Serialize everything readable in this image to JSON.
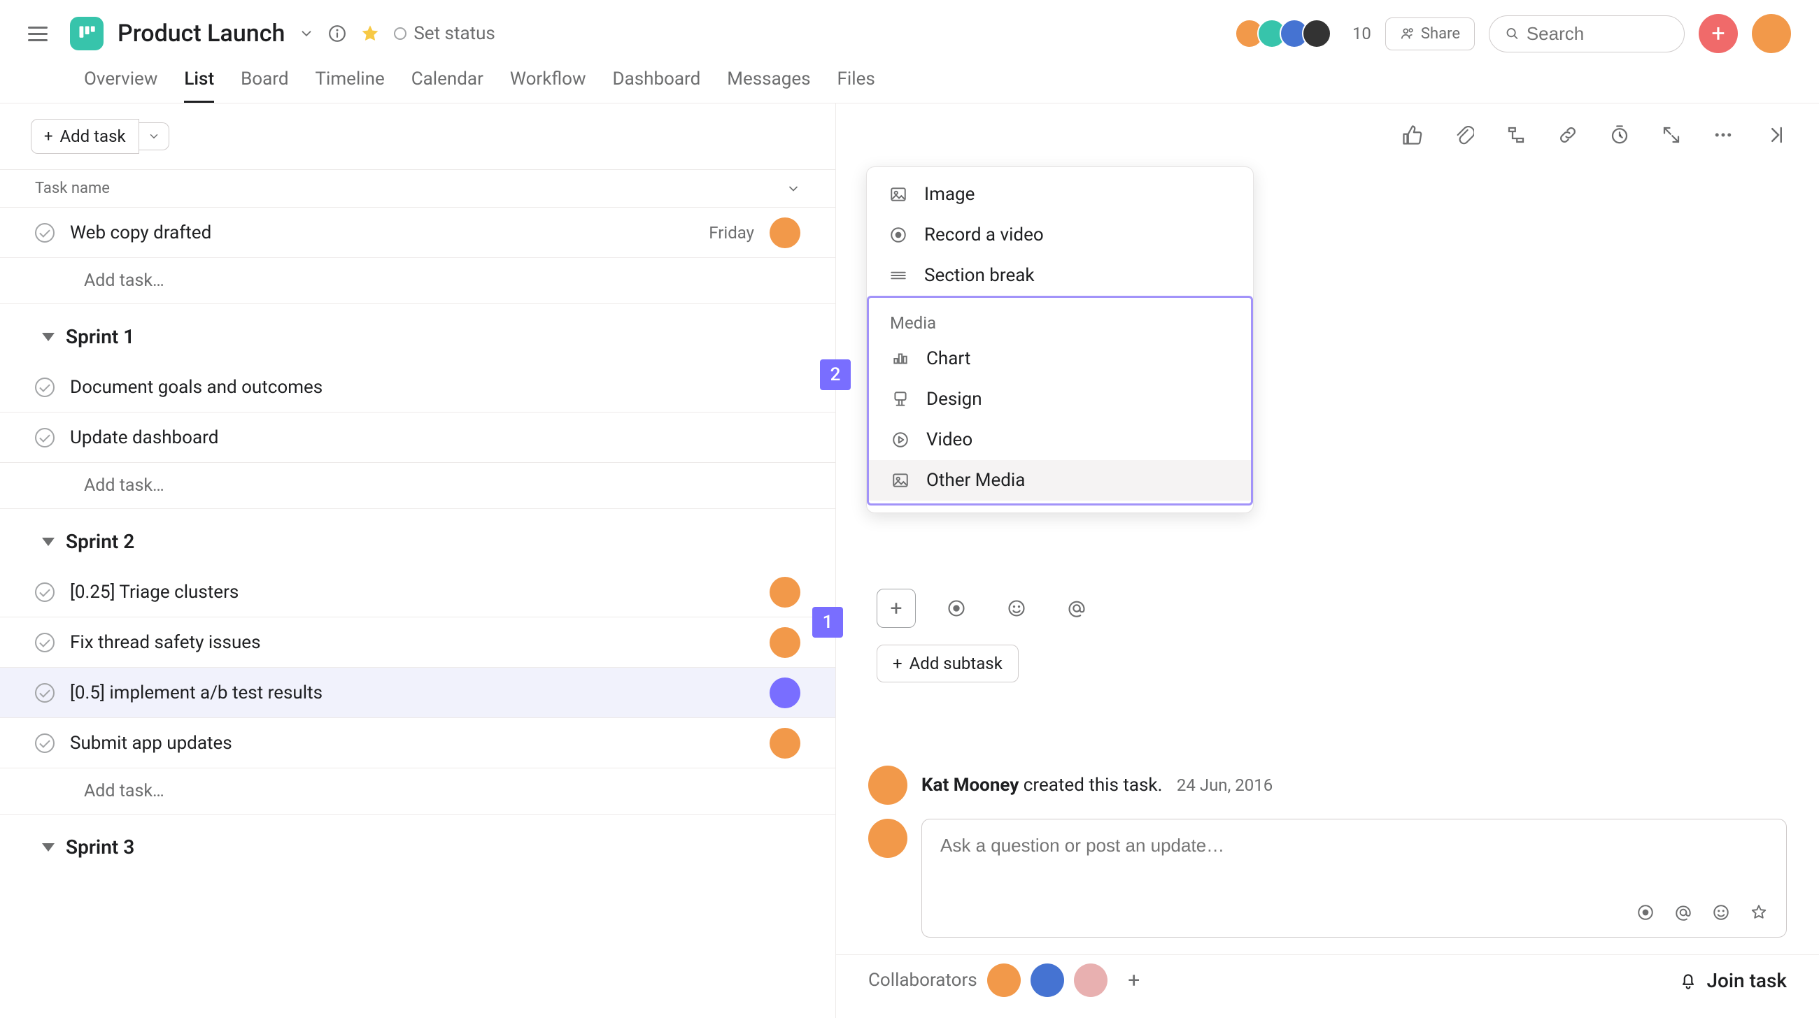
{
  "header": {
    "project_title": "Product Launch",
    "set_status": "Set status",
    "member_count": "10",
    "share_label": "Share",
    "search_placeholder": "Search"
  },
  "tabs": [
    {
      "label": "Overview"
    },
    {
      "label": "List"
    },
    {
      "label": "Board"
    },
    {
      "label": "Timeline"
    },
    {
      "label": "Calendar"
    },
    {
      "label": "Workflow"
    },
    {
      "label": "Dashboard"
    },
    {
      "label": "Messages"
    },
    {
      "label": "Files"
    }
  ],
  "active_tab": "List",
  "list": {
    "add_task_label": "Add task",
    "task_name_col": "Task name",
    "add_task_placeholder": "Add task…",
    "ungrouped": [
      {
        "name": "Web copy drafted",
        "due": "Friday",
        "assignee": "orange"
      }
    ],
    "sections": [
      {
        "title": "Sprint 1",
        "tasks": [
          {
            "name": "Document goals and outcomes"
          },
          {
            "name": "Update dashboard"
          }
        ]
      },
      {
        "title": "Sprint 2",
        "tasks": [
          {
            "name": "[0.25] Triage clusters",
            "assignee": "orange"
          },
          {
            "name": "Fix thread safety issues",
            "assignee": "orange"
          },
          {
            "name": "[0.5] implement a/b test results",
            "assignee": "purple",
            "selected": true
          },
          {
            "name": "Submit app updates",
            "assignee": "orange"
          }
        ]
      },
      {
        "title": "Sprint 3",
        "tasks": []
      }
    ]
  },
  "menu": {
    "top_items": [
      {
        "icon": "image-icon",
        "label": "Image"
      },
      {
        "icon": "record-icon",
        "label": "Record a video"
      },
      {
        "icon": "section-break-icon",
        "label": "Section break"
      }
    ],
    "group_label": "Media",
    "media_items": [
      {
        "icon": "chart-icon",
        "label": "Chart"
      },
      {
        "icon": "design-icon",
        "label": "Design"
      },
      {
        "icon": "video-icon",
        "label": "Video"
      },
      {
        "icon": "other-media-icon",
        "label": "Other Media",
        "hover": true
      }
    ]
  },
  "callouts": {
    "one": "1",
    "two": "2"
  },
  "detail": {
    "add_subtask": "Add subtask",
    "activity_author": "Kat Mooney",
    "activity_text": " created this task.",
    "activity_ts": "24 Jun, 2016",
    "comment_placeholder": "Ask a question or post an update…",
    "collaborators_label": "Collaborators",
    "join_label": "Join task"
  }
}
